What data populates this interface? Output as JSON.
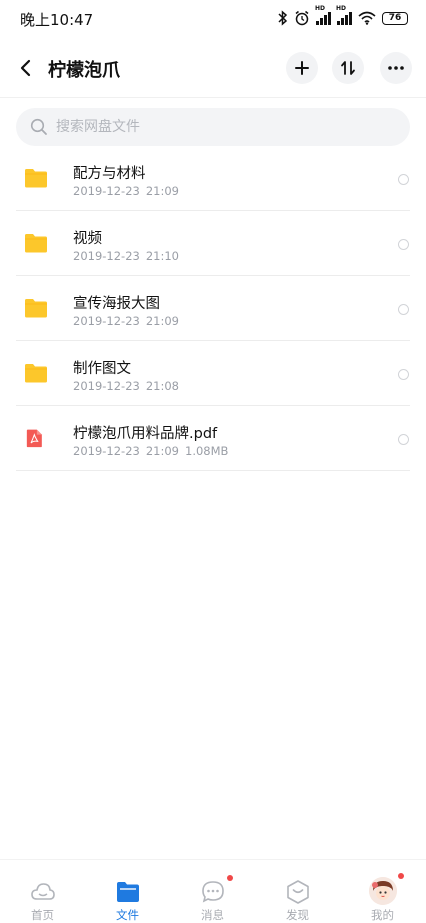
{
  "status_bar": {
    "time": "晚上10:47",
    "battery": "76",
    "network_label": "HD"
  },
  "header": {
    "title": "柠檬泡爪",
    "add_glyph": "+",
    "sort_glyph": "⇅",
    "more_glyph": "•••"
  },
  "search": {
    "placeholder": "搜索网盘文件"
  },
  "files": [
    {
      "name": "配方与材料",
      "date": "2019-12-23",
      "time": "21:09",
      "size": "",
      "type": "folder"
    },
    {
      "name": "视频",
      "date": "2019-12-23",
      "time": "21:10",
      "size": "",
      "type": "folder"
    },
    {
      "name": "宣传海报大图",
      "date": "2019-12-23",
      "time": "21:09",
      "size": "",
      "type": "folder"
    },
    {
      "name": "制作图文",
      "date": "2019-12-23",
      "time": "21:08",
      "size": "",
      "type": "folder"
    },
    {
      "name": "柠檬泡爪用料品牌.pdf",
      "date": "2019-12-23",
      "time": "21:09",
      "size": "1.08MB",
      "type": "pdf"
    }
  ],
  "nav": [
    {
      "label": "首页",
      "icon": "cloud-icon",
      "active": false
    },
    {
      "label": "文件",
      "icon": "folder-icon",
      "active": true
    },
    {
      "label": "消息",
      "icon": "message-icon",
      "active": false,
      "badge": true
    },
    {
      "label": "发现",
      "icon": "discover-icon",
      "active": false
    },
    {
      "label": "我的",
      "icon": "avatar",
      "active": false,
      "badge": true
    }
  ],
  "colors": {
    "folder": "#fcc72b",
    "pdf": "#f35a55",
    "accent": "#1f7ae0",
    "badge": "#f04848"
  }
}
